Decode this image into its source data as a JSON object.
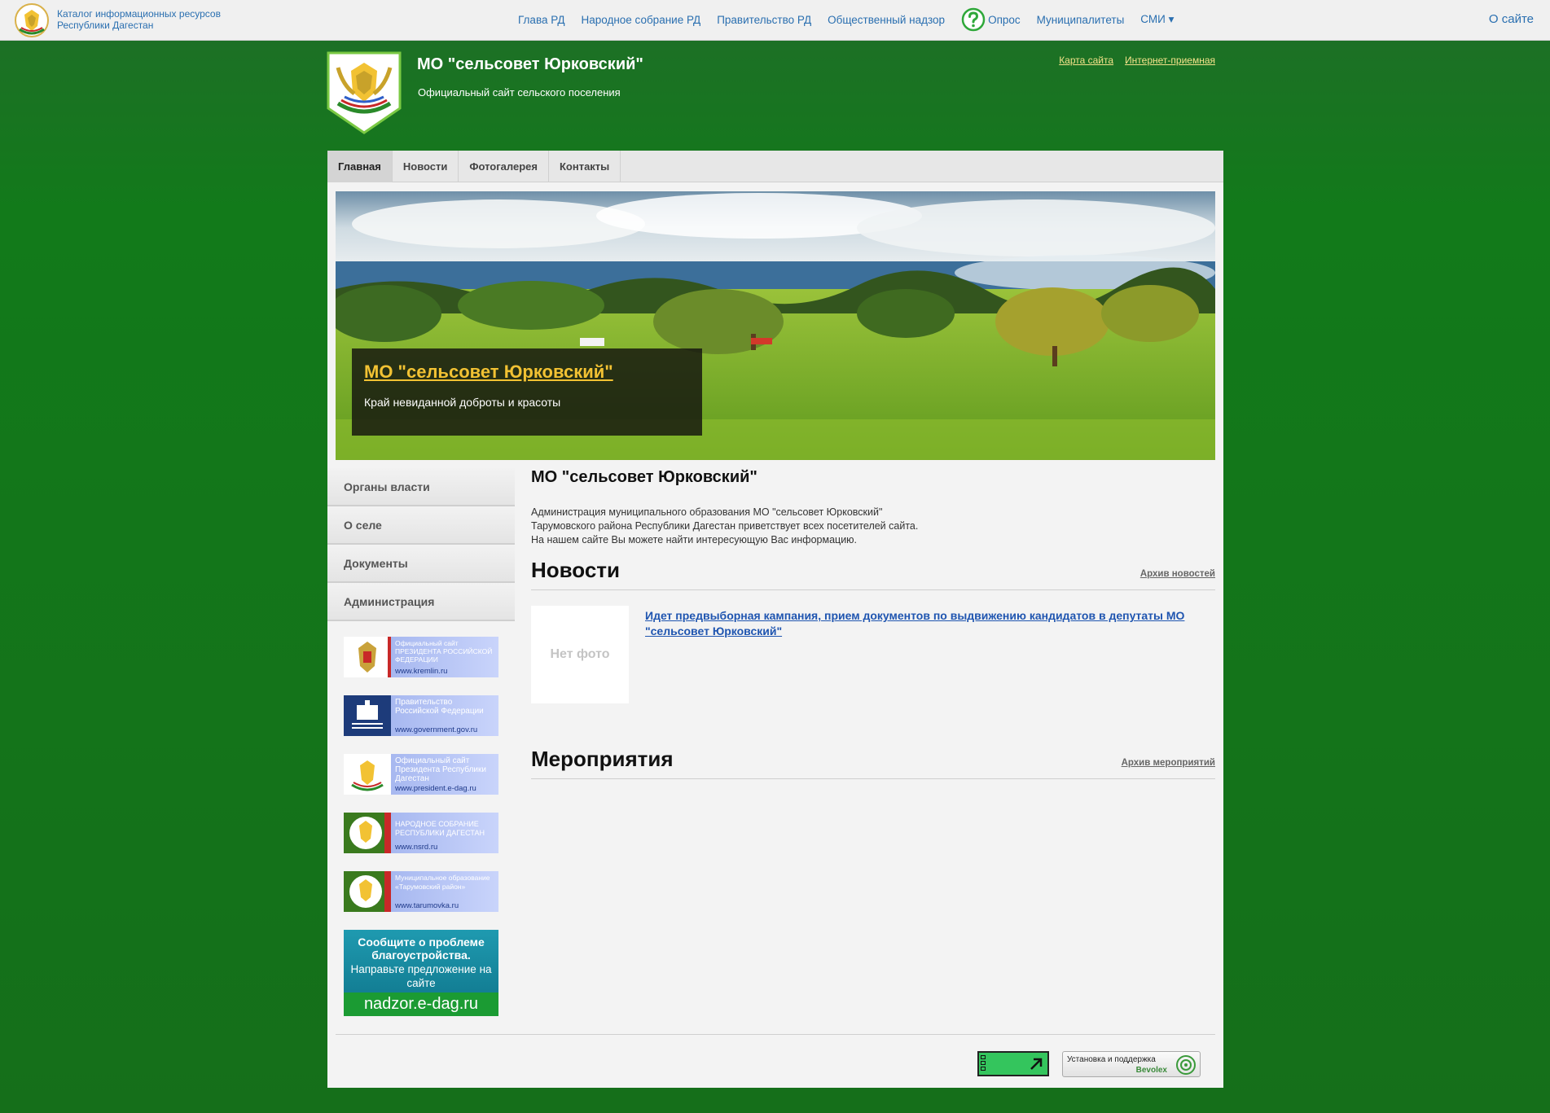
{
  "topbar": {
    "catalog_line1": "Каталог информационных ресурсов",
    "catalog_line2": "Республики Дагестан",
    "nav": [
      {
        "label": "Глава РД"
      },
      {
        "label": "Народное собрание РД"
      },
      {
        "label": "Правительство РД"
      },
      {
        "label": "Общественный надзор"
      },
      {
        "label": "Опрос"
      },
      {
        "label": "Муниципалитеты"
      },
      {
        "label": "СМИ ▾"
      }
    ],
    "about": "О сайте"
  },
  "header": {
    "title": "МО \"сельсовет Юрковский\"",
    "subtitle": "Официальный сайт сельского поселения",
    "links": [
      {
        "label": "Карта сайта"
      },
      {
        "label": "Интернет-приемная"
      }
    ]
  },
  "mainnav": [
    {
      "label": "Главная"
    },
    {
      "label": "Новости"
    },
    {
      "label": "Фотогалерея"
    },
    {
      "label": "Контакты"
    }
  ],
  "banner": {
    "title": "МО \"сельсовет Юрковский\"",
    "text": "Край невиданной доброты и красоты"
  },
  "sidebar": {
    "items": [
      {
        "label": "Органы власти"
      },
      {
        "label": "О селе"
      },
      {
        "label": "Документы"
      },
      {
        "label": "Администрация"
      }
    ],
    "banners": [
      {
        "text": "Официальный сайт ПРЕЗИДЕНТА РОССИЙСКОЙ ФЕДЕРАЦИИ",
        "url": "www.kremlin.ru"
      },
      {
        "text": "Правительство Российской Федерации",
        "url": "www.government.gov.ru"
      },
      {
        "text": "Официальный сайт Президента Республики Дагестан",
        "url": "www.president.e-dag.ru"
      },
      {
        "text": "НАРОДНОЕ СОБРАНИЕ РЕСПУБЛИКИ ДАГЕСТАН",
        "url": "www.nsrd.ru"
      },
      {
        "text": "Муниципальное образование «Тарумовский район»",
        "url": "www.tarumovka.ru"
      }
    ],
    "nadzor": {
      "line1": "Сообщите о проблеме благоустройства.",
      "line2": "Направьте предложение на сайте",
      "url": "nadzor.e-dag.ru"
    }
  },
  "content": {
    "title": "МО \"сельсовет Юрковский\"",
    "intro": [
      "Администрация муниципального образования МО \"сельсовет Юрковский\"",
      "Тарумовского района Республики Дагестан приветствует всех посетителей сайта.",
      "На нашем сайте Вы можете найти интересующую Вас информацию."
    ],
    "news": {
      "heading": "Новости",
      "archive": "Архив новостей",
      "items": [
        {
          "photo": "Нет фото",
          "title": "Идет предвыборная кампания, прием документов по выдвижению кандидатов в депутаты МО \"сельсовет Юрковский\""
        }
      ]
    },
    "events": {
      "heading": "Мероприятия",
      "archive": "Архив мероприятий"
    }
  },
  "footer": {
    "bevolex_line1": "Установка и поддержка",
    "bevolex_line2": "Bevolex"
  }
}
